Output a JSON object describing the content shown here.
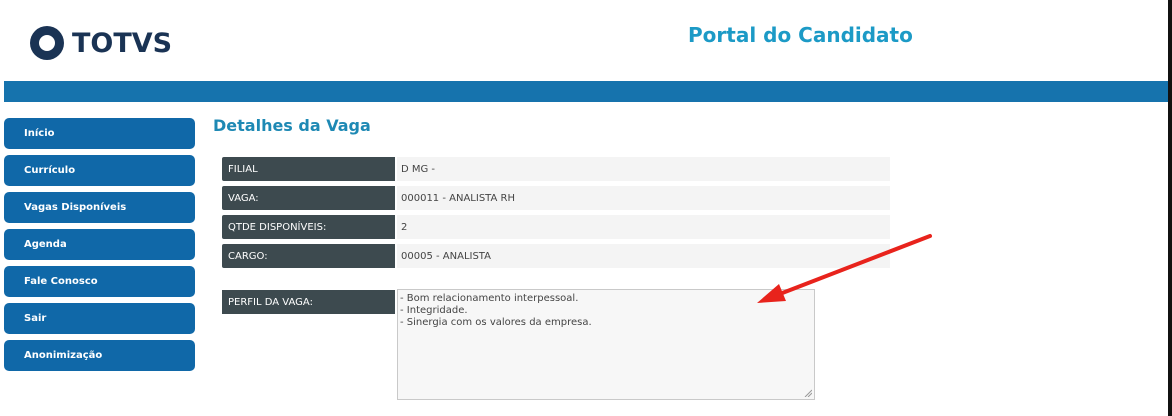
{
  "header": {
    "logo_text": "TOTVS",
    "portal_title": "Portal do Candidato"
  },
  "menu": {
    "items": [
      {
        "label": "Início"
      },
      {
        "label": "Currículo"
      },
      {
        "label": "Vagas Disponíveis"
      },
      {
        "label": "Agenda"
      },
      {
        "label": "Fale Conosco"
      },
      {
        "label": "Sair"
      },
      {
        "label": "Anonimização"
      }
    ]
  },
  "detalhes": {
    "title": "Detalhes da Vaga",
    "rows": [
      {
        "label": "FILIAL",
        "value": "D MG -"
      },
      {
        "label": "VAGA:",
        "value": "000011 - ANALISTA RH"
      },
      {
        "label": "QTDE DISPONÍVEIS:",
        "value": "2"
      },
      {
        "label": "CARGO:",
        "value": "00005 - ANALISTA"
      }
    ],
    "perfil": {
      "label": "PERFIL DA VAGA:",
      "lines": [
        "- Bom relacionamento interpessoal.",
        "- Integridade.",
        "- Sinergia com os valores da empresa."
      ]
    }
  },
  "colors": {
    "brand_dark": "#1a3354",
    "accent": "#1c9ac6",
    "topbar": "#1673ad",
    "menu": "#1068a8",
    "label_bg": "#3d4a4f",
    "arrow": "#e8231c"
  }
}
